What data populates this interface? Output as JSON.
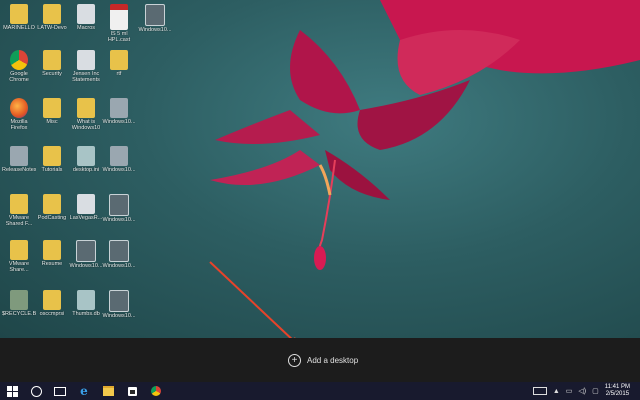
{
  "desktop": {
    "icons": [
      {
        "label": "MARINELLO",
        "glyph": "folder"
      },
      {
        "label": "LATW-Devo",
        "glyph": "folder"
      },
      {
        "label": "Macros",
        "glyph": "doc"
      },
      {
        "label": "IS 5 ml HPL.cast",
        "glyph": "pdf"
      },
      {
        "label": "Windows10...",
        "glyph": "img"
      },
      {
        "label": "Google Chrome",
        "glyph": "chrome"
      },
      {
        "label": "Security",
        "glyph": "folder"
      },
      {
        "label": "Jensen Inc Statements",
        "glyph": "doc"
      },
      {
        "label": "rtf",
        "glyph": "folder"
      },
      {
        "label": "Mozilla Firefox",
        "glyph": "firefox"
      },
      {
        "label": "Misc",
        "glyph": "folder"
      },
      {
        "label": "What is Windows10",
        "glyph": "folder"
      },
      {
        "label": "Windows10...",
        "glyph": "app"
      },
      {
        "label": "ReleaseNotes",
        "glyph": "app"
      },
      {
        "label": "Tutorials",
        "glyph": "folder"
      },
      {
        "label": "desktop.ini",
        "glyph": "shortcut"
      },
      {
        "label": "Windows10...",
        "glyph": "app"
      },
      {
        "label": "VMware Shared F...",
        "glyph": "folder"
      },
      {
        "label": "PodCasting",
        "glyph": "folder"
      },
      {
        "label": "LasVegasR...",
        "glyph": "doc"
      },
      {
        "label": "Windows10...",
        "glyph": "img"
      },
      {
        "label": "VMware Share...",
        "glyph": "folder"
      },
      {
        "label": "Resume",
        "glyph": "folder"
      },
      {
        "label": "Windows10...",
        "glyph": "img"
      },
      {
        "label": "Windows10...",
        "glyph": "img"
      },
      {
        "label": "$RECYCLE.BIN",
        "glyph": "recycle"
      },
      {
        "label": "osccmprsi",
        "glyph": "folder"
      },
      {
        "label": "Thumbs.db",
        "glyph": "shortcut"
      },
      {
        "label": "Windows10...",
        "glyph": "img"
      }
    ]
  },
  "task_view": {
    "add_desktop_label": "Add a desktop",
    "add_icon": "plus-circle-icon"
  },
  "taskbar": {
    "icons": [
      "windows-start-icon",
      "cortana-search-icon",
      "task-view-icon",
      "internet-explorer-icon",
      "file-explorer-icon",
      "store-icon",
      "chrome-icon"
    ],
    "tray_icons": [
      "keyboard-icon",
      "chevron-up-icon",
      "network-icon",
      "volume-icon",
      "notifications-icon"
    ],
    "time": "11:41 PM",
    "date": "2/5/2015"
  },
  "colors": {
    "taskbar": "#181a2e",
    "add_bar": "#1c1c1c",
    "arrow": "#e8432a"
  }
}
